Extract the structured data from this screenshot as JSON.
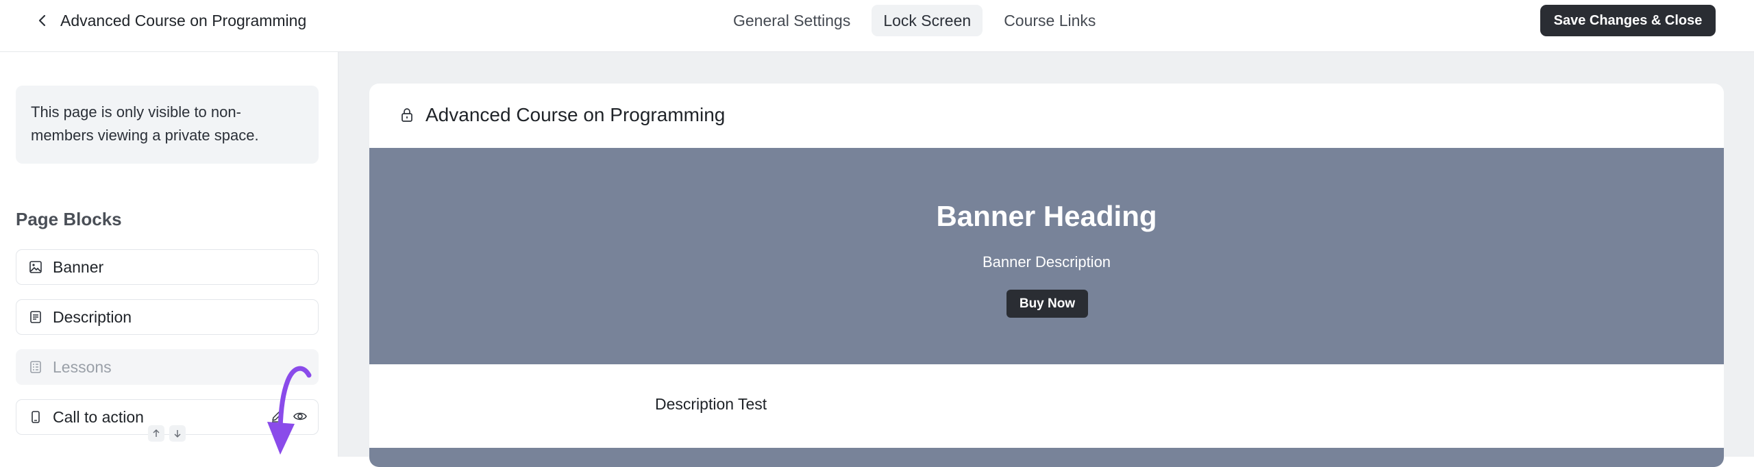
{
  "header": {
    "title": "Advanced Course on Programming",
    "tabs": [
      {
        "label": "General Settings"
      },
      {
        "label": "Lock Screen",
        "active": true
      },
      {
        "label": "Course Links"
      }
    ],
    "save_label": "Save Changes & Close"
  },
  "sidebar": {
    "note": "This page is only visible to non-members viewing a private space.",
    "blocks_heading": "Page Blocks",
    "blocks": [
      {
        "label": "Banner",
        "icon": "image-icon"
      },
      {
        "label": "Description",
        "icon": "document-icon"
      },
      {
        "label": "Lessons",
        "icon": "list-icon",
        "disabled": true
      },
      {
        "label": "Call to action",
        "icon": "phone-icon"
      }
    ]
  },
  "preview": {
    "title": "Advanced Course on Programming",
    "banner_heading": "Banner Heading",
    "banner_description": "Banner Description",
    "buy_label": "Buy Now",
    "description_text": "Description Test"
  },
  "colors": {
    "accent_dark": "#2a2d33",
    "banner_bg": "#788399",
    "annotation_arrow": "#8a4bea"
  }
}
